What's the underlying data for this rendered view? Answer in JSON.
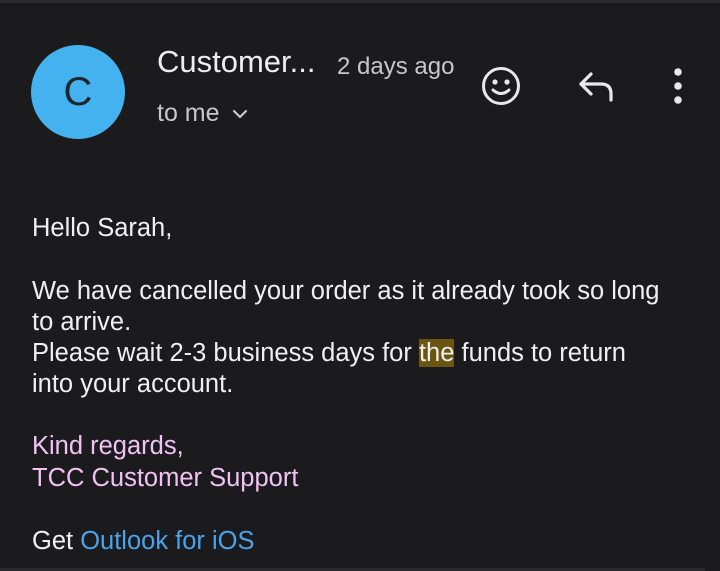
{
  "header": {
    "avatar_letter": "C",
    "avatar_color": "#44b2ef",
    "sender": "Customer...",
    "time": "2 days ago",
    "recipient": "to me"
  },
  "actions": {
    "emoji_icon": "smiley-face-icon",
    "reply_icon": "reply-arrow-icon",
    "more_icon": "vertical-ellipsis-icon"
  },
  "message": {
    "greeting": "Hello Sarah,",
    "line1": "We have cancelled your order as it already took so long",
    "line2": "to arrive.",
    "line3_before": "Please wait 2-3 business days for ",
    "line3_highlight": "the",
    "line3_after": " funds to return",
    "line4": "into your account.",
    "signoff": "Kind regards,",
    "signature": "TCC Customer Support",
    "footer_prefix": "Get ",
    "footer_link": "Outlook for iOS"
  },
  "colors": {
    "background": "#1b1b1e",
    "highlight": "#6b5511",
    "signature": "#f2c1f4",
    "link": "#4aa3ea"
  }
}
